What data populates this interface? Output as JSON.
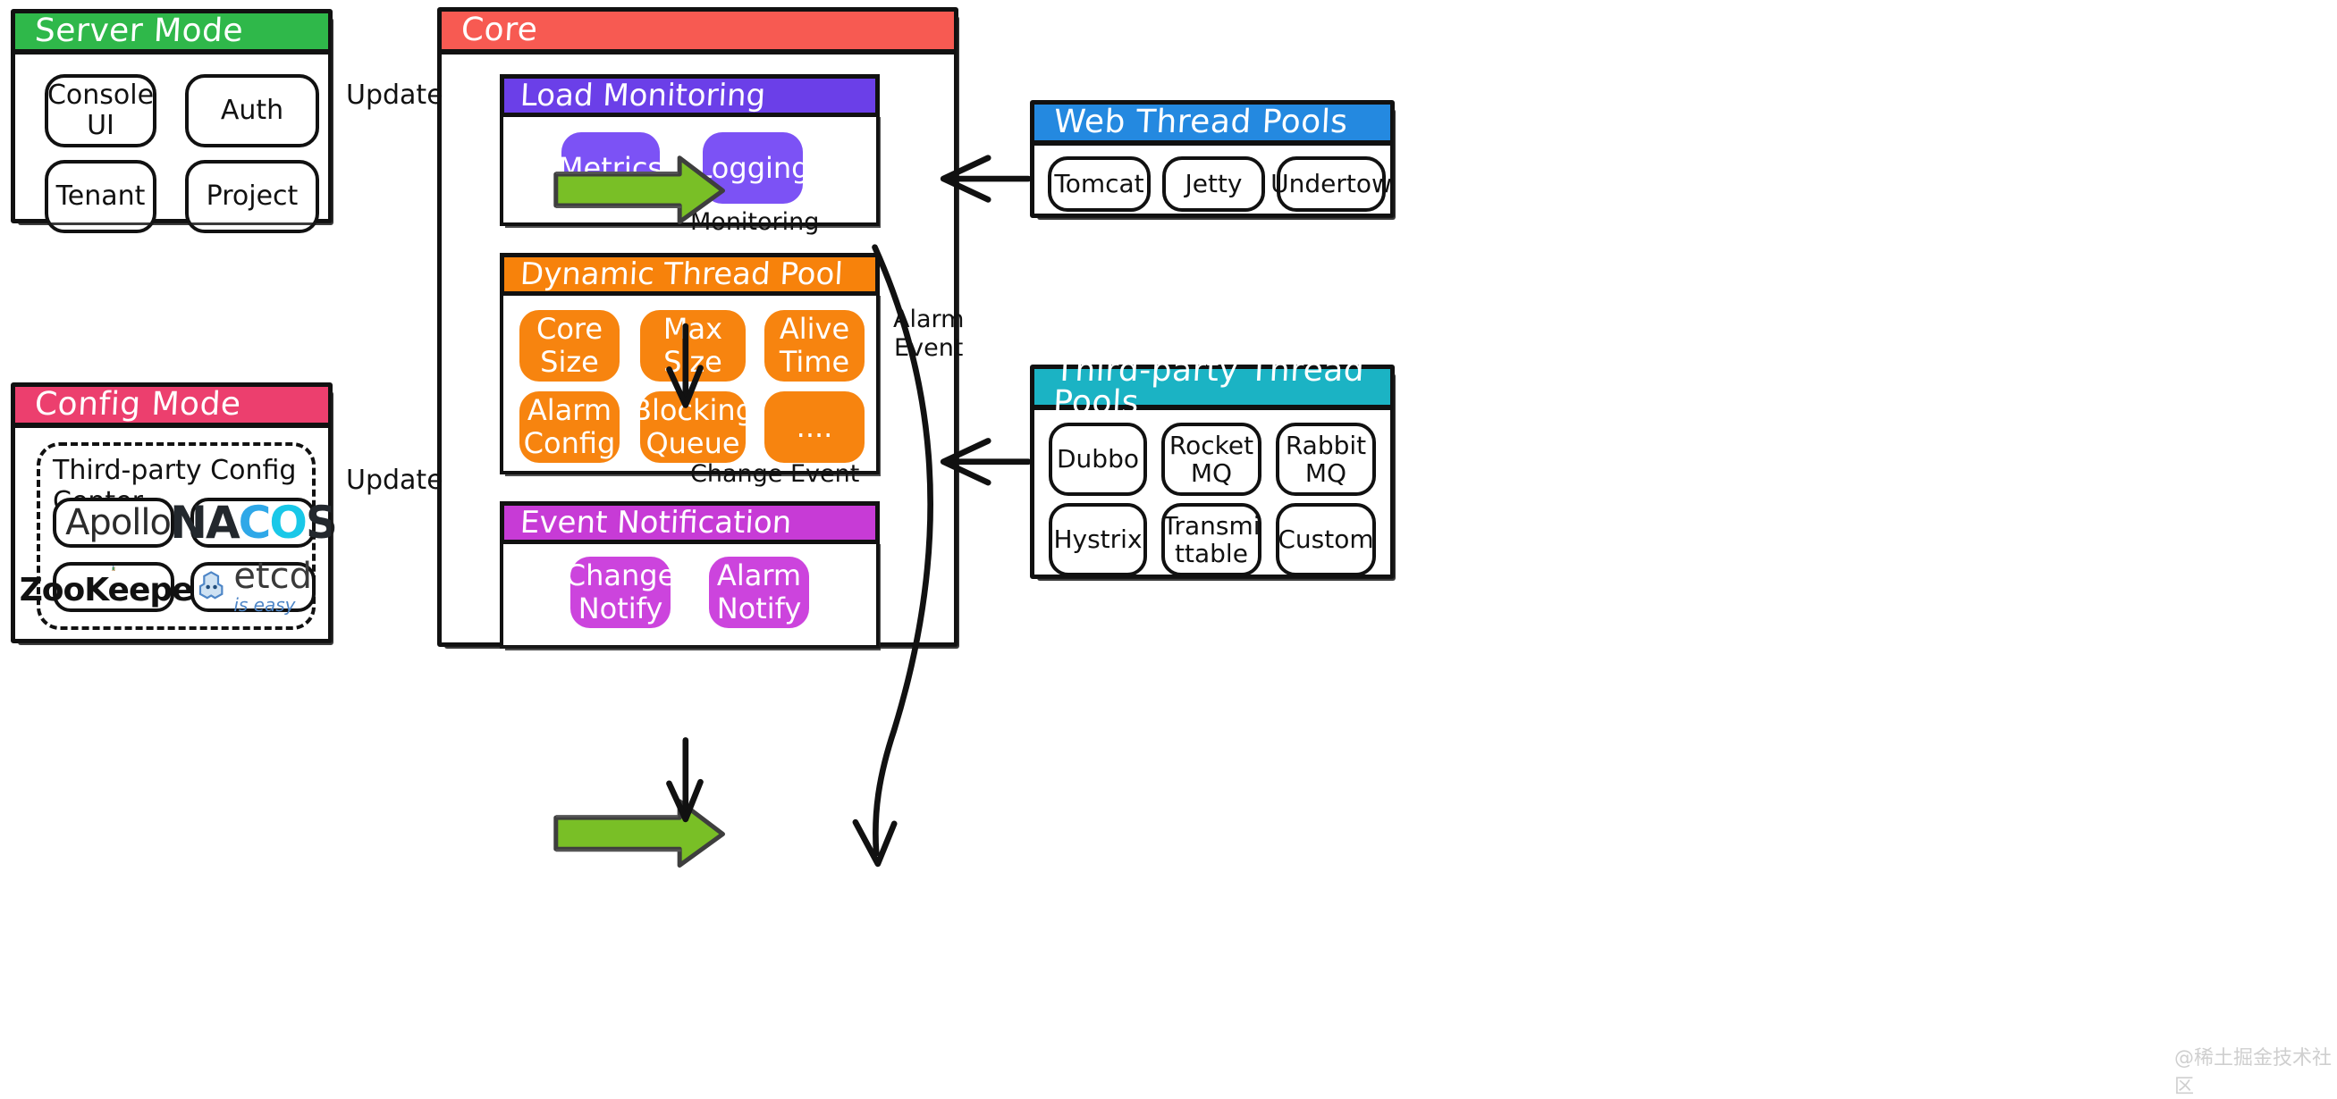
{
  "panels": {
    "server_mode": {
      "title": "Server Mode",
      "color": "#2fb84a",
      "items": [
        {
          "label": "Console\nUI"
        },
        {
          "label": "Auth"
        },
        {
          "label": "Tenant"
        },
        {
          "label": "Project"
        }
      ]
    },
    "config_mode": {
      "title": "Config Mode",
      "color": "#ec3f6e",
      "group_label": "Third-party Config Center",
      "items": [
        {
          "label": "Apollo",
          "icon": "apollo-logo"
        },
        {
          "label": "NACOS",
          "icon": "nacos-logo"
        },
        {
          "label": "ZooKeeper",
          "icon": "zookeeper-logo"
        },
        {
          "label": "etcd",
          "sub": "is easy",
          "icon": "etcd-logo"
        }
      ]
    },
    "core": {
      "title": "Core",
      "color": "#f75a52",
      "sections": [
        {
          "title": "Load Monitoring",
          "header_color": "#6b3fe8",
          "chip_color": "#7c52f5",
          "items": [
            "Metrics",
            "Logging"
          ]
        },
        {
          "title": "Dynamic Thread Pool",
          "header_color": "#f7820b",
          "chip_color": "#f7840f",
          "items": [
            "Core\nSize",
            "Max\nSize",
            "Alive\nTime",
            "Alarm\nConfig",
            "Blocking\nQueue",
            "...."
          ]
        },
        {
          "title": "Event Notification",
          "header_color": "#c73bd6",
          "chip_color": "#cc44dd",
          "items": [
            "Change\nNotify",
            "Alarm\nNotify"
          ]
        }
      ]
    },
    "web_thread_pools": {
      "title": "Web Thread Pools",
      "color": "#2489e0",
      "items": [
        {
          "label": "Tomcat"
        },
        {
          "label": "Jetty"
        },
        {
          "label": "Undertow"
        }
      ]
    },
    "third_party_thread_pools": {
      "title": "Third-party Thread Pools",
      "color": "#1bb3c4",
      "items": [
        {
          "label": "Dubbo"
        },
        {
          "label": "Rocket\nMQ"
        },
        {
          "label": "Rabbit\nMQ"
        },
        {
          "label": "Hystrix"
        },
        {
          "label": "Transmi\nttable"
        },
        {
          "label": "Custom"
        }
      ]
    }
  },
  "arrows": {
    "update_top": {
      "label": "Update",
      "color": "#79bf26"
    },
    "update_bottom": {
      "label": "Update",
      "color": "#79bf26"
    },
    "monitoring": {
      "label": "Monitoring"
    },
    "change_event": {
      "label": "Change Event"
    },
    "alarm_event": {
      "label": "Alarm\nEvent"
    }
  },
  "watermark": "@稀土掘金技术社区"
}
